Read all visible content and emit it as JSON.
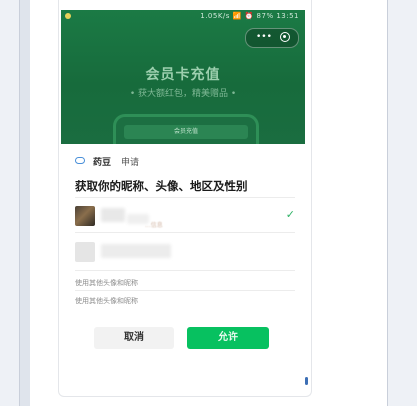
{
  "statusbar": {
    "text": "1.05K/s 📶 ⏰ 87% 13:51"
  },
  "banner": {
    "title": "会员卡充值",
    "subtitle": "• 获大额红包，精美赠品 •",
    "mini_bar_text": "会员充值"
  },
  "capsule": {
    "dots": "•••"
  },
  "dialog": {
    "app_name": "药豆",
    "app_action": "申请",
    "request_title": "获取你的昵称、头像、地区及性别",
    "name_hint": "...信息",
    "use_other_1": "使用其他头像和昵称",
    "use_other_2": "使用其他头像和昵称",
    "cancel_label": "取消",
    "allow_label": "允许"
  },
  "colors": {
    "banner_green": "#1b7a45",
    "allow_green": "#07c160",
    "check_green": "#2fb266"
  }
}
